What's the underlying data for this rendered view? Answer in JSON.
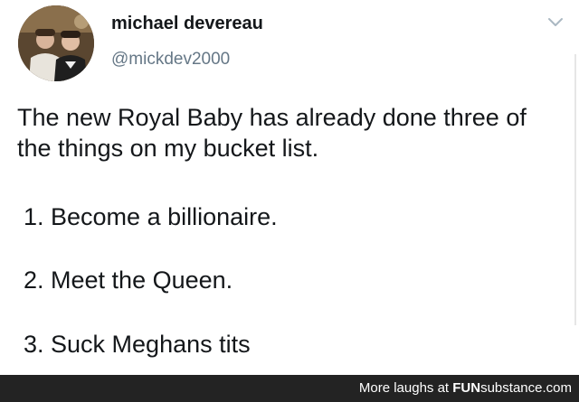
{
  "author": {
    "name": "michael devereau",
    "handle": "@mickdev2000"
  },
  "tweet": {
    "lines": [
      "The new Royal Baby has already done three of",
      "the things on my bucket list."
    ],
    "list": [
      "1. Become a billionaire.",
      "2. Meet the Queen.",
      "3. Suck Meghans tits"
    ]
  },
  "icons": {
    "avatar": "profile-photo",
    "menu": "chevron-down-icon"
  },
  "footer": {
    "prefix": "More laughs at ",
    "site_bold": "FUN",
    "site_rest": "substance",
    "domain": ".com"
  },
  "colors": {
    "text": "#14171a",
    "handle": "#657786",
    "footer_bg": "#232323",
    "footer_text": "#ffffff"
  }
}
